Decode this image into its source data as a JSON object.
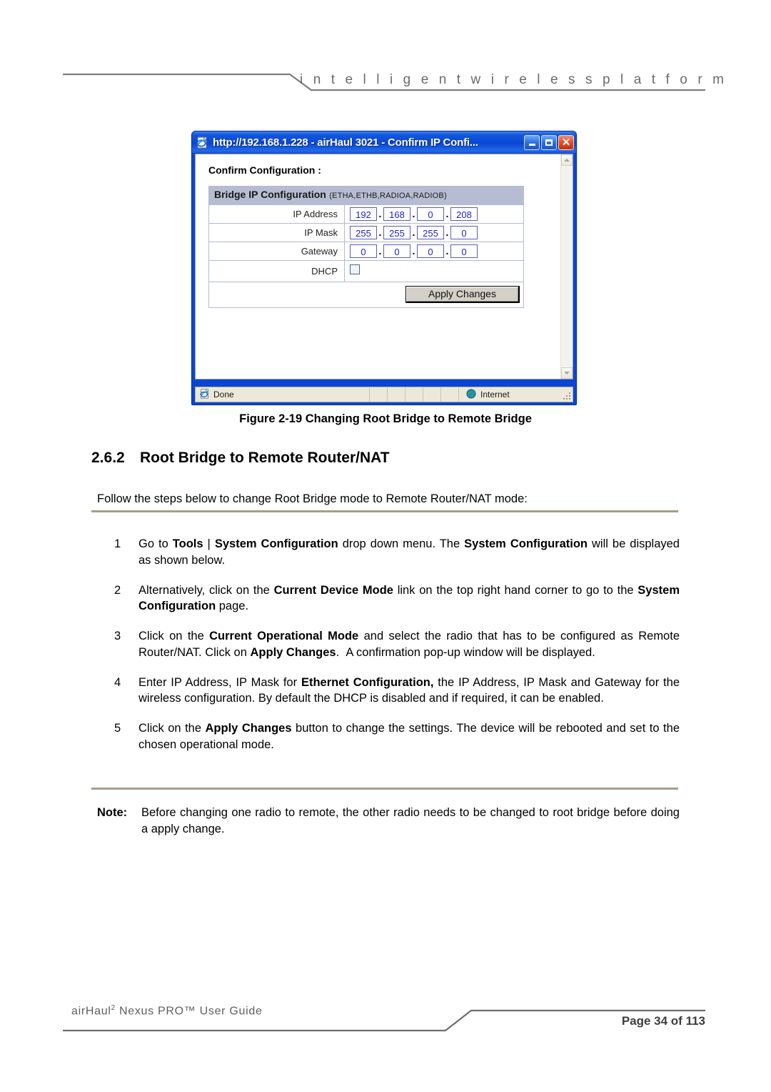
{
  "page_header": {
    "tagline": "i n t e l l i g e n t      w i r e l e s s      p l a t f o r m"
  },
  "figure": {
    "caption": "Figure 2-19 Changing Root Bridge to Remote Bridge",
    "browser": {
      "title": "http://192.168.1.228 - airHaul 3021 - Confirm IP Confi...",
      "minimize_label": "_",
      "maximize_label": "□",
      "close_label": "✕",
      "page_title": "Confirm Configuration :",
      "table": {
        "header_main": "Bridge IP Configuration",
        "header_sub": "(ETHA,ETHB,RADIOA,RADIOB)",
        "rows": [
          {
            "label": "IP Address",
            "octets": [
              "192",
              "168",
              "0",
              "208"
            ]
          },
          {
            "label": "IP Mask",
            "octets": [
              "255",
              "255",
              "255",
              "0"
            ]
          },
          {
            "label": "Gateway",
            "octets": [
              "0",
              "0",
              "0",
              "0"
            ]
          }
        ],
        "dhcp_label": "DHCP",
        "dhcp_checked": false,
        "apply_label": "Apply Changes"
      },
      "statusbar": {
        "status_text": "Done",
        "zone_text": "Internet"
      }
    }
  },
  "section": {
    "number": "2.6.2",
    "title": "Root Bridge to Remote Router/NAT",
    "intro": "Follow the steps below to change Root Bridge mode to Remote Router/NAT mode:",
    "steps": [
      {
        "number": "1",
        "html": "Go to <b>Tools</b> | <b>System Configuration</b> drop down menu. The <b>System Configuration</b> will be displayed as shown below."
      },
      {
        "number": "2",
        "html": "Alternatively, click on the <b>Current Device Mode</b> link on the top right hand corner to go to the <b>System Configuration</b> page."
      },
      {
        "number": "3",
        "html": "Click on the <b>Current Operational Mode</b> and select the radio that has to be configured as Remote Router/NAT. Click on <b>Apply Changes</b>. &nbsp;A confirmation pop-up window will be displayed."
      },
      {
        "number": "4",
        "html": "Enter IP Address, IP Mask for <b>Ethernet Configuration,</b> the IP Address, IP Mask and Gateway for the wireless configuration. By default the DHCP is disabled and if required, it can be enabled."
      },
      {
        "number": "5",
        "html": "Click on the <b>Apply Changes</b> button to change the settings. The device will be rebooted and set to the chosen operational mode."
      }
    ],
    "note_label": "Note:",
    "note_text": "Before changing one radio to remote, the other radio needs to be changed to root bridge before doing a apply change."
  },
  "page_footer": {
    "guide_title_html": "airHaul<sup>2</sup> Nexus PRO™ User Guide",
    "page_number": "Page 34 of 113"
  },
  "colors": {
    "titlebar_blue": "#0a46d2",
    "table_header": "#b6bdd2",
    "input_text": "#2222cc",
    "rule_tan": "#a89d8a",
    "statusbar_bg": "#ece9d8"
  }
}
